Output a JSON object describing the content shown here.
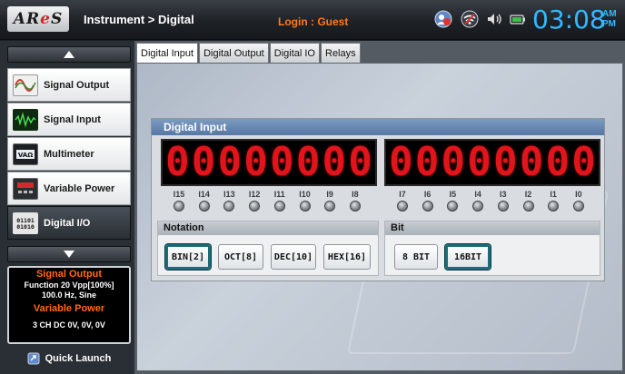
{
  "app": {
    "logo_text": "ARes",
    "breadcrumb": "Instrument > Digital",
    "login": "Login :  Guest"
  },
  "header_icons": [
    "user-switch-icon",
    "wifi-icon",
    "volume-icon",
    "battery-icon"
  ],
  "clock": {
    "time": "03:08",
    "am": "AM",
    "pm": "PM"
  },
  "sidebar": {
    "items": [
      {
        "label": "Signal Output",
        "icon": "sine-wave-icon"
      },
      {
        "label": "Signal Input",
        "icon": "waveform-icon"
      },
      {
        "label": "Multimeter",
        "icon": "meter-icon"
      },
      {
        "label": "Variable Power",
        "icon": "power-supply-icon"
      },
      {
        "label": "Digital I/O",
        "icon": "binary-icon",
        "active": true
      }
    ],
    "status": {
      "signal_output_title": "Signal Output",
      "signal_output_line1": "Function 20 Vpp[100%]",
      "signal_output_line2": "100.0 Hz, Sine",
      "variable_power_title": "Variable Power",
      "variable_power_line": "3 CH DC 0V, 0V, 0V"
    },
    "quick_launch": "Quick Launch"
  },
  "tabs": [
    {
      "label": "Digital Input",
      "active": true
    },
    {
      "label": "Digital Output"
    },
    {
      "label": "Digital IO"
    },
    {
      "label": "Relays"
    }
  ],
  "digital_input": {
    "title": "Digital Input",
    "high_digits": [
      "0",
      "0",
      "0",
      "0",
      "0",
      "0",
      "0",
      "0"
    ],
    "low_digits": [
      "0",
      "0",
      "0",
      "0",
      "0",
      "0",
      "0",
      "0"
    ],
    "high_labels": [
      "I15",
      "I14",
      "I13",
      "I12",
      "I11",
      "I10",
      "I9",
      "I8"
    ],
    "low_labels": [
      "I7",
      "I6",
      "I5",
      "I4",
      "I3",
      "I2",
      "I1",
      "I0"
    ],
    "notation": {
      "title": "Notation",
      "buttons": [
        "BIN[2]",
        "OCT[8]",
        "DEC[10]",
        "HEX[16]"
      ],
      "selected": "BIN[2]"
    },
    "bit": {
      "title": "Bit",
      "buttons": [
        "8 BIT",
        "16BIT"
      ],
      "selected": "16BIT"
    }
  },
  "colors": {
    "clock": "#33b8ff",
    "login": "#ff7a1c",
    "segment": "#e1141c",
    "panel_title": "#5f7fab"
  }
}
